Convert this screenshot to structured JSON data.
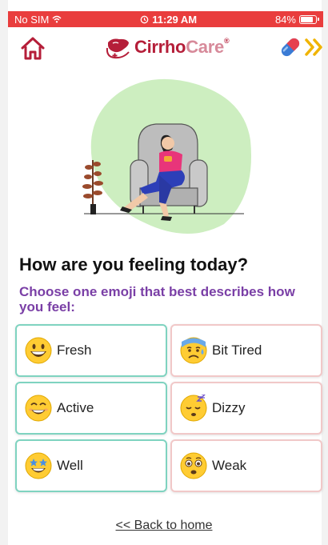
{
  "status_bar": {
    "carrier": "No SIM",
    "time": "11:29 AM",
    "battery_percent": "84%",
    "battery_level": 0.84,
    "color": "#e93d3d"
  },
  "header": {
    "home_icon": "home-icon",
    "logo": {
      "part1": "Cirrho",
      "part2": "Care",
      "mark": "®"
    },
    "pill_icon": "pill-icon",
    "next_icon": "double-chevron-right-icon"
  },
  "illustration": {
    "name": "woman-sitting-in-armchair-illustration"
  },
  "question": {
    "title": "How are you feeling today?",
    "subtitle": "Choose one emoji that best describes how you feel:"
  },
  "moods": [
    {
      "label": "Fresh",
      "icon": "grinning-face-icon"
    },
    {
      "label": "Bit Tired",
      "icon": "sweating-face-icon"
    },
    {
      "label": "Active",
      "icon": "smiling-face-icon"
    },
    {
      "label": "Dizzy",
      "icon": "sleepy-face-icon"
    },
    {
      "label": "Well",
      "icon": "star-struck-face-icon"
    },
    {
      "label": "Weak",
      "icon": "frowning-face-icon"
    }
  ],
  "colors": {
    "brand": "#b51e39",
    "brand_light": "#d78a9a",
    "accent_purple": "#7a3fa6",
    "good_border": "#7fd3c0",
    "bad_border": "#f1c8c8"
  },
  "footer": {
    "back_label": "<< Back to home"
  }
}
